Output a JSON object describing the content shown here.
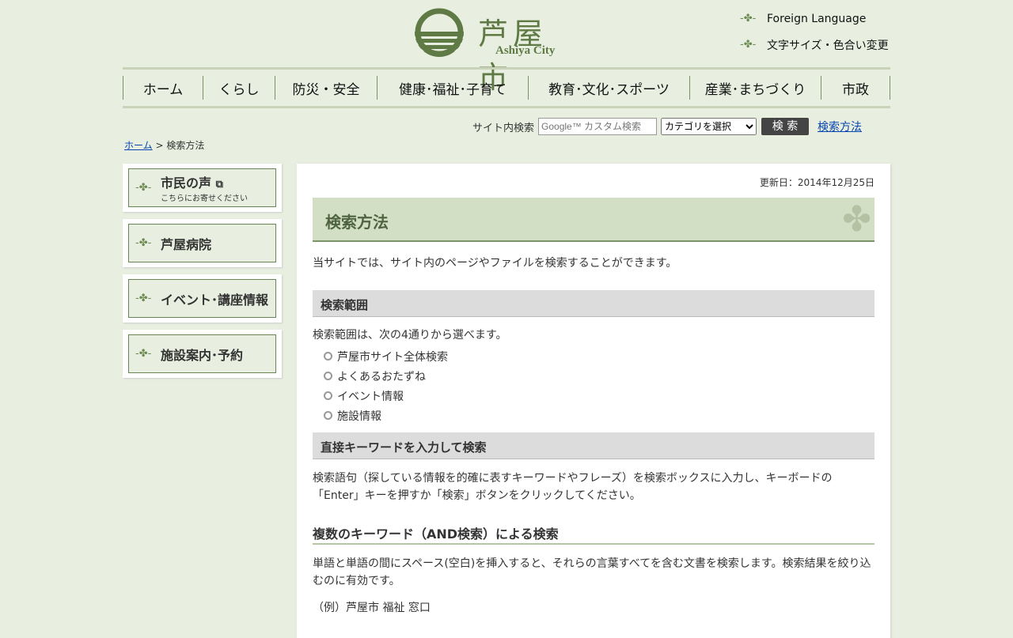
{
  "header": {
    "logo_title": "芦屋市",
    "logo_sub": "Ashiya City",
    "foreign_language": "Foreign Language",
    "text_size": "文字サイズ・色合い変更"
  },
  "nav": [
    "ホーム",
    "くらし",
    "防災・安全",
    "健康･福祉･子育て",
    "教育･文化･スポーツ",
    "産業･まちづくり",
    "市政"
  ],
  "search": {
    "label": "サイト内検索",
    "placeholder": "Google™ カスタム検索",
    "category": "カテゴリを選択",
    "button": "検 索",
    "help_link": "検索方法"
  },
  "breadcrumb": {
    "home": "ホーム",
    "sep": ">",
    "current": "検索方法"
  },
  "sidebar": [
    {
      "label": "市民の声",
      "sub": "こちらにお寄せください"
    },
    {
      "label": "芦屋病院"
    },
    {
      "label": "イベント･講座情報"
    },
    {
      "label": "施設案内･予約"
    }
  ],
  "main": {
    "updated": "更新日：2014年12月25日",
    "title": "検索方法",
    "intro": "当サイトでは、サイト内のページやファイルを検索することができます。",
    "h_scope": "検索範囲",
    "scope_text": "検索範囲は、次の4通りから選べます。",
    "scope_items": [
      "芦屋市サイト全体検索",
      "よくあるおたずね",
      "イベント情報",
      "施設情報"
    ],
    "h_direct": "直接キーワードを入力して検索",
    "direct_text": "検索語句（探している情報を的確に表すキーワードやフレーズ）を検索ボックスに入力し、キーボードの「Enter」キーを押すか「検索」ボタンをクリックしてください。",
    "h_and": "複数のキーワード（AND検索）による検索",
    "and_text": "単語と単語の間にスペース(空白)を挿入すると、それらの言葉すべてを含む文書を検索します。検索結果を絞り込むのに有効です。",
    "example": "（例）芦屋市 福祉 窓口"
  }
}
